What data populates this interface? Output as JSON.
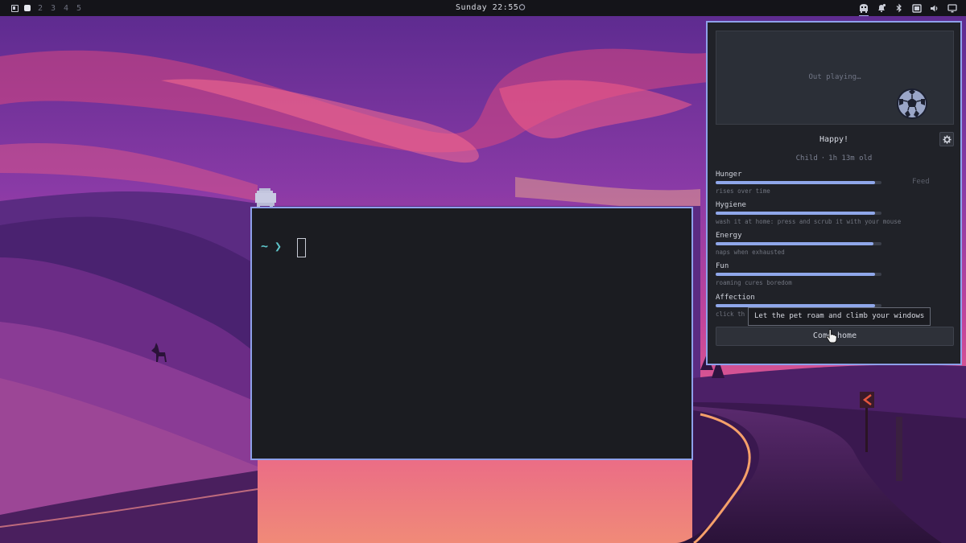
{
  "topbar": {
    "workspaces": [
      "2",
      "3",
      "4",
      "5"
    ],
    "clock": "Sunday 22:55",
    "tray_icons": [
      "pet-icon",
      "notification-icon",
      "bluetooth-icon",
      "screen-icon",
      "volume-icon",
      "display-icon"
    ]
  },
  "terminal": {
    "prompt_symbol": "~",
    "prompt_arrow": "❯",
    "input": ""
  },
  "pet_panel": {
    "scene_status": "Out playing…",
    "mood": "Happy!",
    "stage": "Child",
    "age": "1h 13m old",
    "stats": [
      {
        "name": "Hunger",
        "level": 0.96,
        "hint": "rises over time",
        "action": "Feed"
      },
      {
        "name": "Hygiene",
        "level": 0.96,
        "hint": "wash it at home: press and scrub it with your mouse"
      },
      {
        "name": "Energy",
        "level": 0.95,
        "hint": "naps when exhausted"
      },
      {
        "name": "Fun",
        "level": 0.96,
        "hint": "roaming cures boredom"
      },
      {
        "name": "Affection",
        "level": 0.96,
        "hint": "click th"
      }
    ],
    "tooltip": "Let the pet roam and climb your windows",
    "come_home_label": "Come home"
  },
  "colors": {
    "accent": "#8ea0ea",
    "stat_fill": "#8fa7ea",
    "prompt": "#5ec4c9"
  }
}
